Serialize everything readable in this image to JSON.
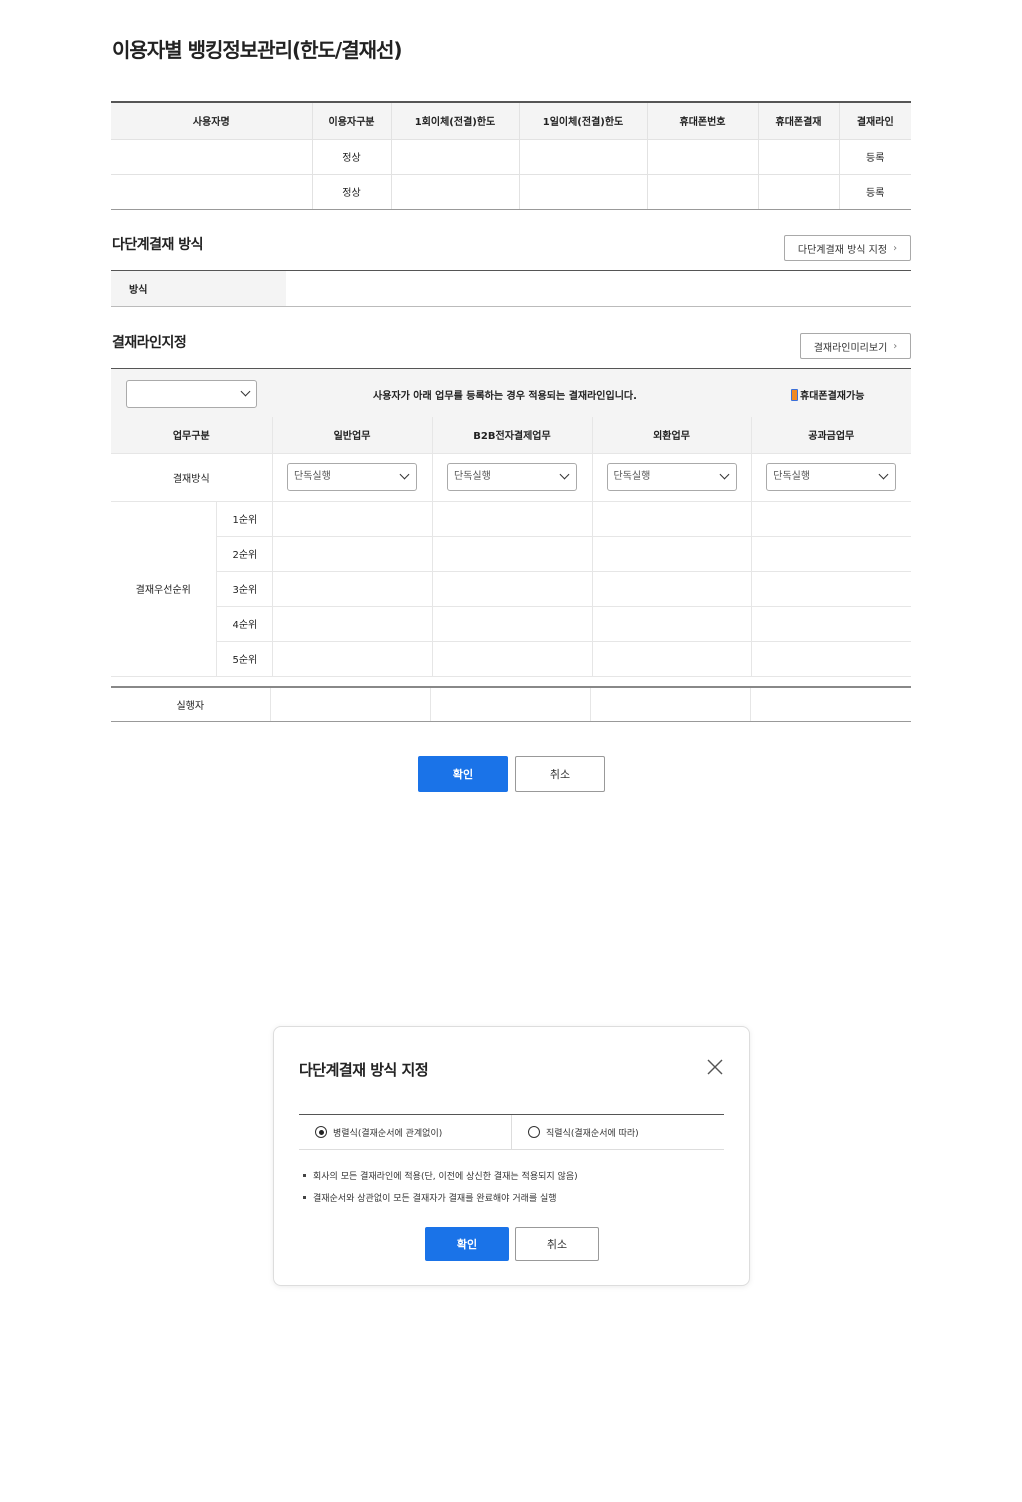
{
  "page": {
    "title": "이용자별 뱅킹정보관리(한도/결재선)"
  },
  "user_table": {
    "columns": [
      "사용자명",
      "이용자구분",
      "1회이체(전결)한도",
      "1일이체(전결)한도",
      "휴대폰번호",
      "휴대폰결재",
      "결재라인"
    ],
    "rows": [
      [
        "",
        "정상",
        "",
        "",
        "",
        "",
        "등록"
      ],
      [
        "",
        "정상",
        "",
        "",
        "",
        "",
        "등록"
      ]
    ]
  },
  "multi_approval": {
    "title": "다단계결재 방식",
    "button": "다단계결재 방식 지정",
    "method_label": "방식",
    "method_value": ""
  },
  "approval_line": {
    "title": "결재라인지정",
    "preview_button": "결재라인미리보기",
    "select_value": "",
    "description": "사용자가 아래 업무를 등록하는 경우 적용되는 결재라인입니다.",
    "mobile_label": "휴대폰결재가능",
    "columns": [
      "업무구분",
      "일반업무",
      "B2B전자결제업무",
      "외환업무",
      "공과금업무"
    ],
    "method_row_label": "결재방식",
    "method_options": [
      "단독실행",
      "단독실행",
      "단독실행",
      "단독실행"
    ],
    "priority_label": "결재우선순위",
    "ranks": [
      "1순위",
      "2순위",
      "3순위",
      "4순위",
      "5순위"
    ],
    "executor_label": "실행자"
  },
  "actions": {
    "confirm": "확인",
    "cancel": "취소"
  },
  "modal": {
    "title": "다단계결재 방식 지정",
    "option_parallel": "병렬식(결재순서에 관계없이)",
    "option_serial": "직렬식(결재순서에 따라)",
    "selected": "parallel",
    "notes": [
      "회사의 모든 결재라인에 적용(단, 이전에 상신한 결재는 적용되지 않음)",
      "결재순서와 상관없이 모든 결재자가 결재를 완료해야 거래를 실행"
    ],
    "confirm": "확인",
    "cancel": "취소"
  },
  "colors": {
    "primary": "#1a73e8",
    "header_bg": "#f4f4f4",
    "border": "#555555"
  }
}
